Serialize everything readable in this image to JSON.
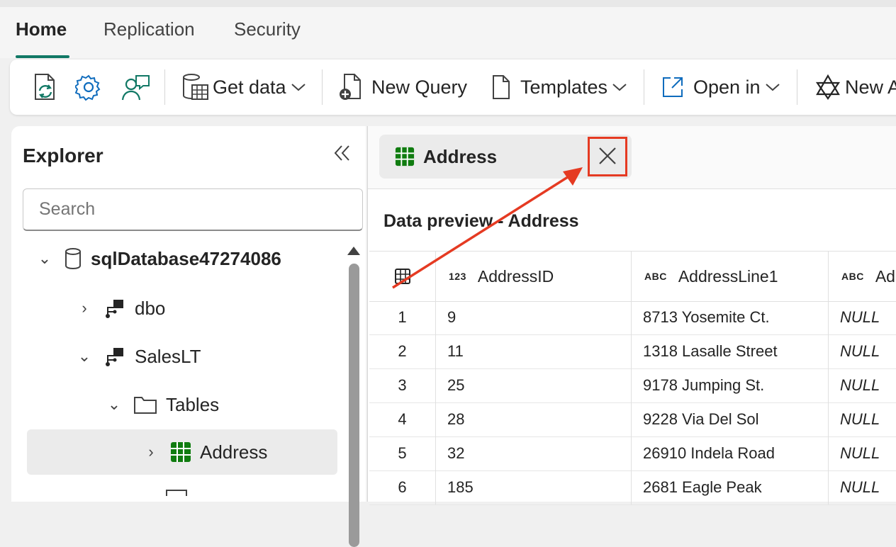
{
  "tabs": [
    {
      "label": "Home",
      "active": true
    },
    {
      "label": "Replication",
      "active": false
    },
    {
      "label": "Security",
      "active": false
    }
  ],
  "toolbar": {
    "icons": [
      "refresh-doc-icon",
      "settings-gear-icon",
      "feedback-person-icon"
    ],
    "get_data": "Get data",
    "new_query": "New Query",
    "templates": "Templates",
    "open_in": "Open in",
    "new_partial": "New A"
  },
  "explorer": {
    "title": "Explorer",
    "search_placeholder": "Search",
    "tree": [
      {
        "label": "sqlDatabase47274086",
        "level": 0,
        "expanded": true,
        "icon": "database-icon"
      },
      {
        "label": "dbo",
        "level": 1,
        "expanded": false,
        "icon": "schema-icon"
      },
      {
        "label": "SalesLT",
        "level": 1,
        "expanded": true,
        "icon": "schema-icon"
      },
      {
        "label": "Tables",
        "level": 2,
        "expanded": true,
        "icon": "folder-icon"
      },
      {
        "label": "Address",
        "level": 3,
        "expanded": false,
        "icon": "table-icon",
        "selected": true
      }
    ]
  },
  "document": {
    "tab_label": "Address",
    "preview_title": "Data preview - Address",
    "columns": [
      {
        "type": "123",
        "label": "AddressID"
      },
      {
        "type": "ABC",
        "label": "AddressLine1"
      },
      {
        "type": "ABC",
        "label": "Ad"
      }
    ],
    "rows": [
      {
        "n": "1",
        "id": "9",
        "line1": "8713 Yosemite Ct.",
        "line2": "NULL"
      },
      {
        "n": "2",
        "id": "11",
        "line1": "1318 Lasalle Street",
        "line2": "NULL"
      },
      {
        "n": "3",
        "id": "25",
        "line1": "9178 Jumping St.",
        "line2": "NULL"
      },
      {
        "n": "4",
        "id": "28",
        "line1": "9228 Via Del Sol",
        "line2": "NULL"
      },
      {
        "n": "5",
        "id": "32",
        "line1": "26910 Indela Road",
        "line2": "NULL"
      },
      {
        "n": "6",
        "id": "185",
        "line1": "2681 Eagle Peak",
        "line2": "NULL"
      }
    ]
  },
  "colors": {
    "accent": "#117865",
    "highlight": "#e53a22",
    "table_icon": "#107c10"
  }
}
